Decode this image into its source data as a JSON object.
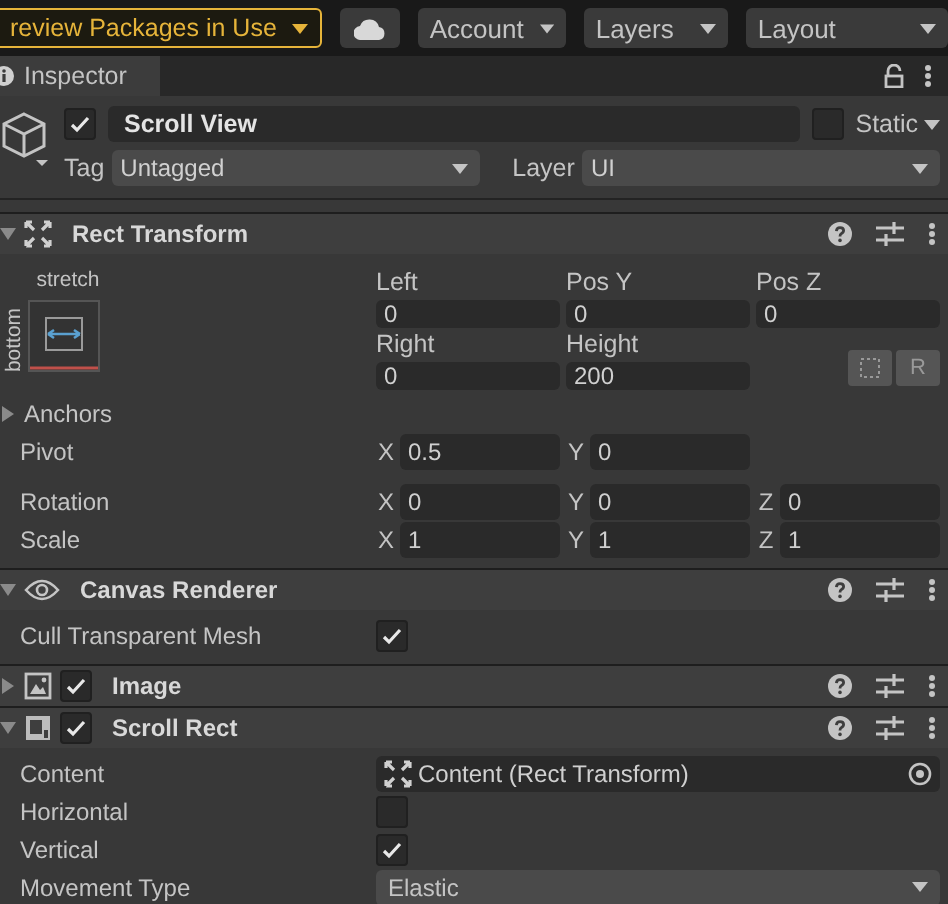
{
  "toolbar": {
    "preview_button": "review Packages in Use",
    "account": "Account",
    "layers": "Layers",
    "layout": "Layout"
  },
  "inspector_tab": {
    "title": "Inspector"
  },
  "object": {
    "active": true,
    "name": "Scroll View",
    "static": false,
    "static_label": "Static",
    "tag_label": "Tag",
    "tag": "Untagged",
    "layer_label": "Layer",
    "layer": "UI"
  },
  "components": [
    {
      "kind": "rect_transform",
      "title": "Rect Transform",
      "expanded": true,
      "anchor": {
        "horizontal": "stretch",
        "vertical": "bottom"
      },
      "position_rows": [
        [
          {
            "label": "Left",
            "value": "0"
          },
          {
            "label": "Pos Y",
            "value": "0"
          },
          {
            "label": "Pos Z",
            "value": "0"
          }
        ],
        [
          {
            "label": "Right",
            "value": "0"
          },
          {
            "label": "Height",
            "value": "200"
          }
        ]
      ],
      "raw_button": "R",
      "rows": [
        {
          "kind": "foldout",
          "label": "Anchors",
          "expanded": false
        },
        {
          "kind": "vector",
          "label": "Pivot",
          "fields": [
            {
              "axis": "X",
              "value": "0.5"
            },
            {
              "axis": "Y",
              "value": "0"
            }
          ]
        },
        {
          "kind": "vector",
          "label": "Rotation",
          "fields": [
            {
              "axis": "X",
              "value": "0"
            },
            {
              "axis": "Y",
              "value": "0"
            },
            {
              "axis": "Z",
              "value": "0"
            }
          ]
        },
        {
          "kind": "vector",
          "label": "Scale",
          "fields": [
            {
              "axis": "X",
              "value": "1"
            },
            {
              "axis": "Y",
              "value": "1"
            },
            {
              "axis": "Z",
              "value": "1"
            }
          ]
        }
      ]
    },
    {
      "kind": "canvas_renderer",
      "title": "Canvas Renderer",
      "expanded": true,
      "rows": [
        {
          "kind": "checkbox",
          "label": "Cull Transparent Mesh",
          "checked": true
        }
      ]
    },
    {
      "kind": "image",
      "title": "Image",
      "expanded": false,
      "enabled": true
    },
    {
      "kind": "scroll_rect",
      "title": "Scroll Rect",
      "expanded": true,
      "enabled": true,
      "rows": [
        {
          "kind": "object",
          "label": "Content",
          "value": "Content (Rect Transform)"
        },
        {
          "kind": "checkbox",
          "label": "Horizontal",
          "checked": false
        },
        {
          "kind": "checkbox",
          "label": "Vertical",
          "checked": true
        },
        {
          "kind": "dropdown",
          "label": "Movement Type",
          "value": "Elastic"
        }
      ]
    }
  ]
}
